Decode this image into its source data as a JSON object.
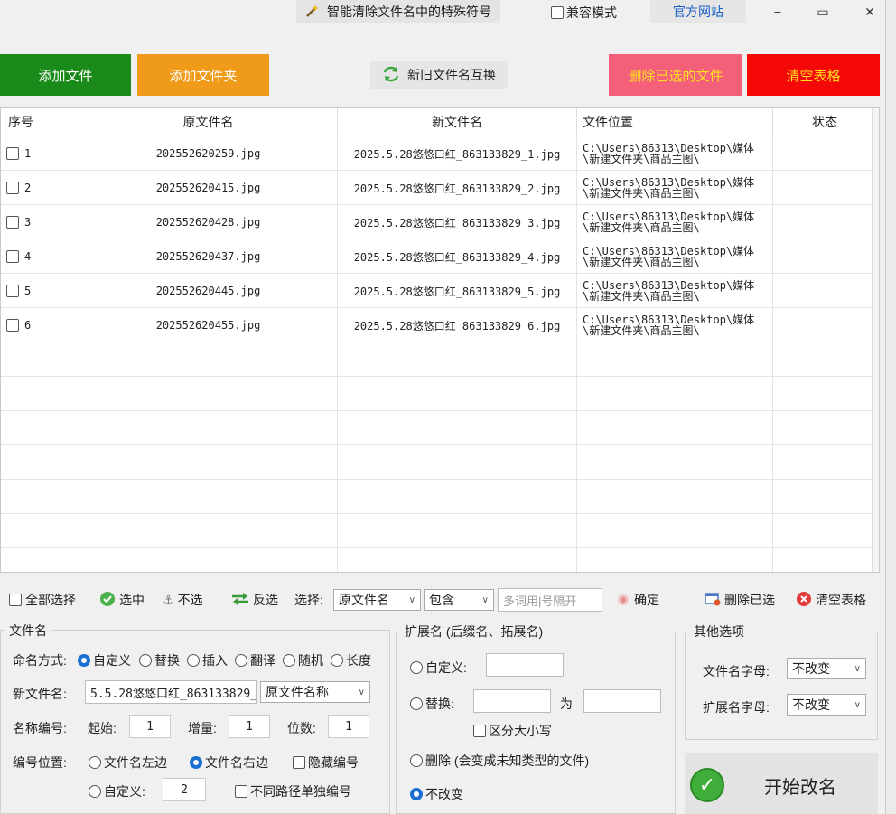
{
  "titlebar": {
    "app_title": "智能清除文件名中的特殊符号",
    "compat_label": "兼容模式",
    "official_site": "官方网站",
    "minimize": "−",
    "maximize": "▭",
    "close": "✕"
  },
  "toolbar": {
    "add_file": "添加文件",
    "add_folder": "添加文件夹",
    "swap_names": "新旧文件名互换",
    "delete_selected": "删除已选的文件",
    "clear_table": "清空表格"
  },
  "colors": {
    "add_file": "#1a8a1a",
    "add_folder": "#f09a1a",
    "delete_selected": "#f4607a",
    "delete_selected_text": "#ffe020",
    "clear_table": "#f40808",
    "accent": "#1a6fd0"
  },
  "table": {
    "headers": [
      "序号",
      "原文件名",
      "新文件名",
      "文件位置",
      "状态"
    ],
    "rows": [
      {
        "num": "1",
        "old": "202552620259.jpg",
        "new": "2025.5.28悠悠口红_863133829_1.jpg",
        "loc1": "C:\\Users\\86313\\Desktop\\媒体",
        "loc2": "\\新建文件夹\\商品主图\\",
        "status": ""
      },
      {
        "num": "2",
        "old": "202552620415.jpg",
        "new": "2025.5.28悠悠口红_863133829_2.jpg",
        "loc1": "C:\\Users\\86313\\Desktop\\媒体",
        "loc2": "\\新建文件夹\\商品主图\\",
        "status": ""
      },
      {
        "num": "3",
        "old": "202552620428.jpg",
        "new": "2025.5.28悠悠口红_863133829_3.jpg",
        "loc1": "C:\\Users\\86313\\Desktop\\媒体",
        "loc2": "\\新建文件夹\\商品主图\\",
        "status": ""
      },
      {
        "num": "4",
        "old": "202552620437.jpg",
        "new": "2025.5.28悠悠口红_863133829_4.jpg",
        "loc1": "C:\\Users\\86313\\Desktop\\媒体",
        "loc2": "\\新建文件夹\\商品主图\\",
        "status": ""
      },
      {
        "num": "5",
        "old": "202552620445.jpg",
        "new": "2025.5.28悠悠口红_863133829_5.jpg",
        "loc1": "C:\\Users\\86313\\Desktop\\媒体",
        "loc2": "\\新建文件夹\\商品主图\\",
        "status": ""
      },
      {
        "num": "6",
        "old": "202552620455.jpg",
        "new": "2025.5.28悠悠口红_863133829_6.jpg",
        "loc1": "C:\\Users\\86313\\Desktop\\媒体",
        "loc2": "\\新建文件夹\\商品主图\\",
        "status": ""
      }
    ]
  },
  "actions": {
    "select_all": "全部选择",
    "check": "选中",
    "uncheck": "不选",
    "invert": "反选",
    "select_label": "选择:",
    "field_select": "原文件名",
    "match_select": "包含",
    "keyword_placeholder": "多词用|号隔开",
    "confirm": "确定",
    "delete_selected": "删除已选",
    "clear_table": "清空表格"
  },
  "filename_group": {
    "title": "文件名",
    "mode_label": "命名方式:",
    "modes": [
      "自定义",
      "替换",
      "插入",
      "翻译",
      "随机",
      "长度"
    ],
    "new_name_label": "新文件名:",
    "new_name_value": "5.5.28悠悠口红_863133829_",
    "name_source": "原文件名称",
    "numbering_label": "名称编号:",
    "start_label": "起始:",
    "start_value": "1",
    "step_label": "增量:",
    "step_value": "1",
    "digits_label": "位数:",
    "digits_value": "1",
    "position_label": "编号位置:",
    "pos_left": "文件名左边",
    "pos_right": "文件名右边",
    "hide_number": "隐藏编号",
    "pos_custom": "自定义:",
    "custom_value": "2",
    "separate_paths": "不同路径单独编号"
  },
  "extension_group": {
    "title": "扩展名 (后缀名、拓展名)",
    "custom": "自定义:",
    "replace": "替换:",
    "to": "为",
    "case_sensitive": "区分大小写",
    "delete": "删除 (会变成未知类型的文件)",
    "unchanged": "不改变"
  },
  "other_group": {
    "title": "其他选项",
    "filename_case_label": "文件名字母:",
    "filename_case_value": "不改变",
    "ext_case_label": "扩展名字母:",
    "ext_case_value": "不改变"
  },
  "start_button": "开始改名"
}
